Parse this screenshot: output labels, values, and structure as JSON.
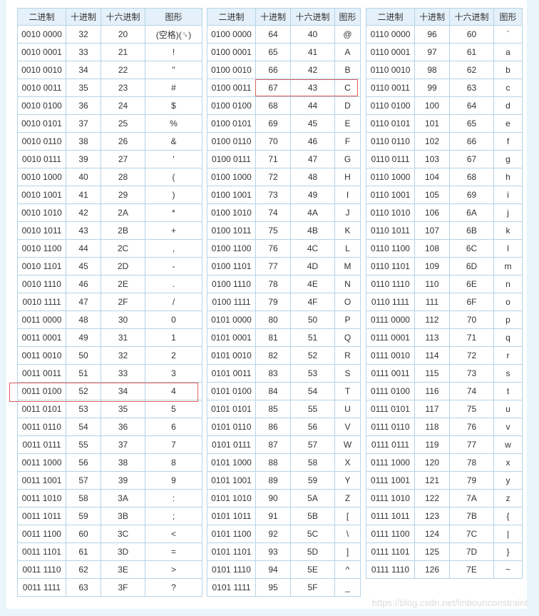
{
  "headers": [
    "二进制",
    "十进制",
    "十六进制",
    "图形"
  ],
  "tables": [
    {
      "rows": [
        [
          "0010 0000",
          "32",
          "20",
          "(空格)(␠)"
        ],
        [
          "0010 0001",
          "33",
          "21",
          "!"
        ],
        [
          "0010 0010",
          "34",
          "22",
          "\""
        ],
        [
          "0010 0011",
          "35",
          "23",
          "#"
        ],
        [
          "0010 0100",
          "36",
          "24",
          "$"
        ],
        [
          "0010 0101",
          "37",
          "25",
          "%"
        ],
        [
          "0010 0110",
          "38",
          "26",
          "&"
        ],
        [
          "0010 0111",
          "39",
          "27",
          "'"
        ],
        [
          "0010 1000",
          "40",
          "28",
          "("
        ],
        [
          "0010 1001",
          "41",
          "29",
          ")"
        ],
        [
          "0010 1010",
          "42",
          "2A",
          "*"
        ],
        [
          "0010 1011",
          "43",
          "2B",
          "+"
        ],
        [
          "0010 1100",
          "44",
          "2C",
          ","
        ],
        [
          "0010 1101",
          "45",
          "2D",
          "-"
        ],
        [
          "0010 1110",
          "46",
          "2E",
          "."
        ],
        [
          "0010 1111",
          "47",
          "2F",
          "/"
        ],
        [
          "0011 0000",
          "48",
          "30",
          "0"
        ],
        [
          "0011 0001",
          "49",
          "31",
          "1"
        ],
        [
          "0011 0010",
          "50",
          "32",
          "2"
        ],
        [
          "0011 0011",
          "51",
          "33",
          "3"
        ],
        [
          "0011 0100",
          "52",
          "34",
          "4"
        ],
        [
          "0011 0101",
          "53",
          "35",
          "5"
        ],
        [
          "0011 0110",
          "54",
          "36",
          "6"
        ],
        [
          "0011 0111",
          "55",
          "37",
          "7"
        ],
        [
          "0011 1000",
          "56",
          "38",
          "8"
        ],
        [
          "0011 1001",
          "57",
          "39",
          "9"
        ],
        [
          "0011 1010",
          "58",
          "3A",
          ":"
        ],
        [
          "0011 1011",
          "59",
          "3B",
          ";"
        ],
        [
          "0011 1100",
          "60",
          "3C",
          "<"
        ],
        [
          "0011 1101",
          "61",
          "3D",
          "="
        ],
        [
          "0011 1110",
          "62",
          "3E",
          ">"
        ],
        [
          "0011 1111",
          "63",
          "3F",
          "?"
        ]
      ]
    },
    {
      "rows": [
        [
          "0100 0000",
          "64",
          "40",
          "@"
        ],
        [
          "0100 0001",
          "65",
          "41",
          "A"
        ],
        [
          "0100 0010",
          "66",
          "42",
          "B"
        ],
        [
          "0100 0011",
          "67",
          "43",
          "C"
        ],
        [
          "0100 0100",
          "68",
          "44",
          "D"
        ],
        [
          "0100 0101",
          "69",
          "45",
          "E"
        ],
        [
          "0100 0110",
          "70",
          "46",
          "F"
        ],
        [
          "0100 0111",
          "71",
          "47",
          "G"
        ],
        [
          "0100 1000",
          "72",
          "48",
          "H"
        ],
        [
          "0100 1001",
          "73",
          "49",
          "I"
        ],
        [
          "0100 1010",
          "74",
          "4A",
          "J"
        ],
        [
          "0100 1011",
          "75",
          "4B",
          "K"
        ],
        [
          "0100 1100",
          "76",
          "4C",
          "L"
        ],
        [
          "0100 1101",
          "77",
          "4D",
          "M"
        ],
        [
          "0100 1110",
          "78",
          "4E",
          "N"
        ],
        [
          "0100 1111",
          "79",
          "4F",
          "O"
        ],
        [
          "0101 0000",
          "80",
          "50",
          "P"
        ],
        [
          "0101 0001",
          "81",
          "51",
          "Q"
        ],
        [
          "0101 0010",
          "82",
          "52",
          "R"
        ],
        [
          "0101 0011",
          "83",
          "53",
          "S"
        ],
        [
          "0101 0100",
          "84",
          "54",
          "T"
        ],
        [
          "0101 0101",
          "85",
          "55",
          "U"
        ],
        [
          "0101 0110",
          "86",
          "56",
          "V"
        ],
        [
          "0101 0111",
          "87",
          "57",
          "W"
        ],
        [
          "0101 1000",
          "88",
          "58",
          "X"
        ],
        [
          "0101 1001",
          "89",
          "59",
          "Y"
        ],
        [
          "0101 1010",
          "90",
          "5A",
          "Z"
        ],
        [
          "0101 1011",
          "91",
          "5B",
          "["
        ],
        [
          "0101 1100",
          "92",
          "5C",
          "\\"
        ],
        [
          "0101 1101",
          "93",
          "5D",
          "]"
        ],
        [
          "0101 1110",
          "94",
          "5E",
          "^"
        ],
        [
          "0101 1111",
          "95",
          "5F",
          "_"
        ]
      ]
    },
    {
      "rows": [
        [
          "0110 0000",
          "96",
          "60",
          "`"
        ],
        [
          "0110 0001",
          "97",
          "61",
          "a"
        ],
        [
          "0110 0010",
          "98",
          "62",
          "b"
        ],
        [
          "0110 0011",
          "99",
          "63",
          "c"
        ],
        [
          "0110 0100",
          "100",
          "64",
          "d"
        ],
        [
          "0110 0101",
          "101",
          "65",
          "e"
        ],
        [
          "0110 0110",
          "102",
          "66",
          "f"
        ],
        [
          "0110 0111",
          "103",
          "67",
          "g"
        ],
        [
          "0110 1000",
          "104",
          "68",
          "h"
        ],
        [
          "0110 1001",
          "105",
          "69",
          "i"
        ],
        [
          "0110 1010",
          "106",
          "6A",
          "j"
        ],
        [
          "0110 1011",
          "107",
          "6B",
          "k"
        ],
        [
          "0110 1100",
          "108",
          "6C",
          "l"
        ],
        [
          "0110 1101",
          "109",
          "6D",
          "m"
        ],
        [
          "0110 1110",
          "110",
          "6E",
          "n"
        ],
        [
          "0110 1111",
          "111",
          "6F",
          "o"
        ],
        [
          "0111 0000",
          "112",
          "70",
          "p"
        ],
        [
          "0111 0001",
          "113",
          "71",
          "q"
        ],
        [
          "0111 0010",
          "114",
          "72",
          "r"
        ],
        [
          "0111 0011",
          "115",
          "73",
          "s"
        ],
        [
          "0111 0100",
          "116",
          "74",
          "t"
        ],
        [
          "0111 0101",
          "117",
          "75",
          "u"
        ],
        [
          "0111 0110",
          "118",
          "76",
          "v"
        ],
        [
          "0111 0111",
          "119",
          "77",
          "w"
        ],
        [
          "0111 1000",
          "120",
          "78",
          "x"
        ],
        [
          "0111 1001",
          "121",
          "79",
          "y"
        ],
        [
          "0111 1010",
          "122",
          "7A",
          "z"
        ],
        [
          "0111 1011",
          "123",
          "7B",
          "{"
        ],
        [
          "0111 1100",
          "124",
          "7C",
          "|"
        ],
        [
          "0111 1101",
          "125",
          "7D",
          "}"
        ],
        [
          "0111 1110",
          "126",
          "7E",
          "~"
        ]
      ]
    }
  ],
  "highlights": [
    {
      "table": 0,
      "row": 20,
      "color": "#e06060"
    },
    {
      "table": 1,
      "row": 3,
      "color": "#e06060"
    }
  ],
  "watermark": "https://blog.csdn.net/linbounconstraint",
  "colors": {
    "header_bg": "#e4f0fa",
    "border": "#b6d3e6",
    "page_bg": "#eaf5fb",
    "highlight": "#e06060"
  }
}
